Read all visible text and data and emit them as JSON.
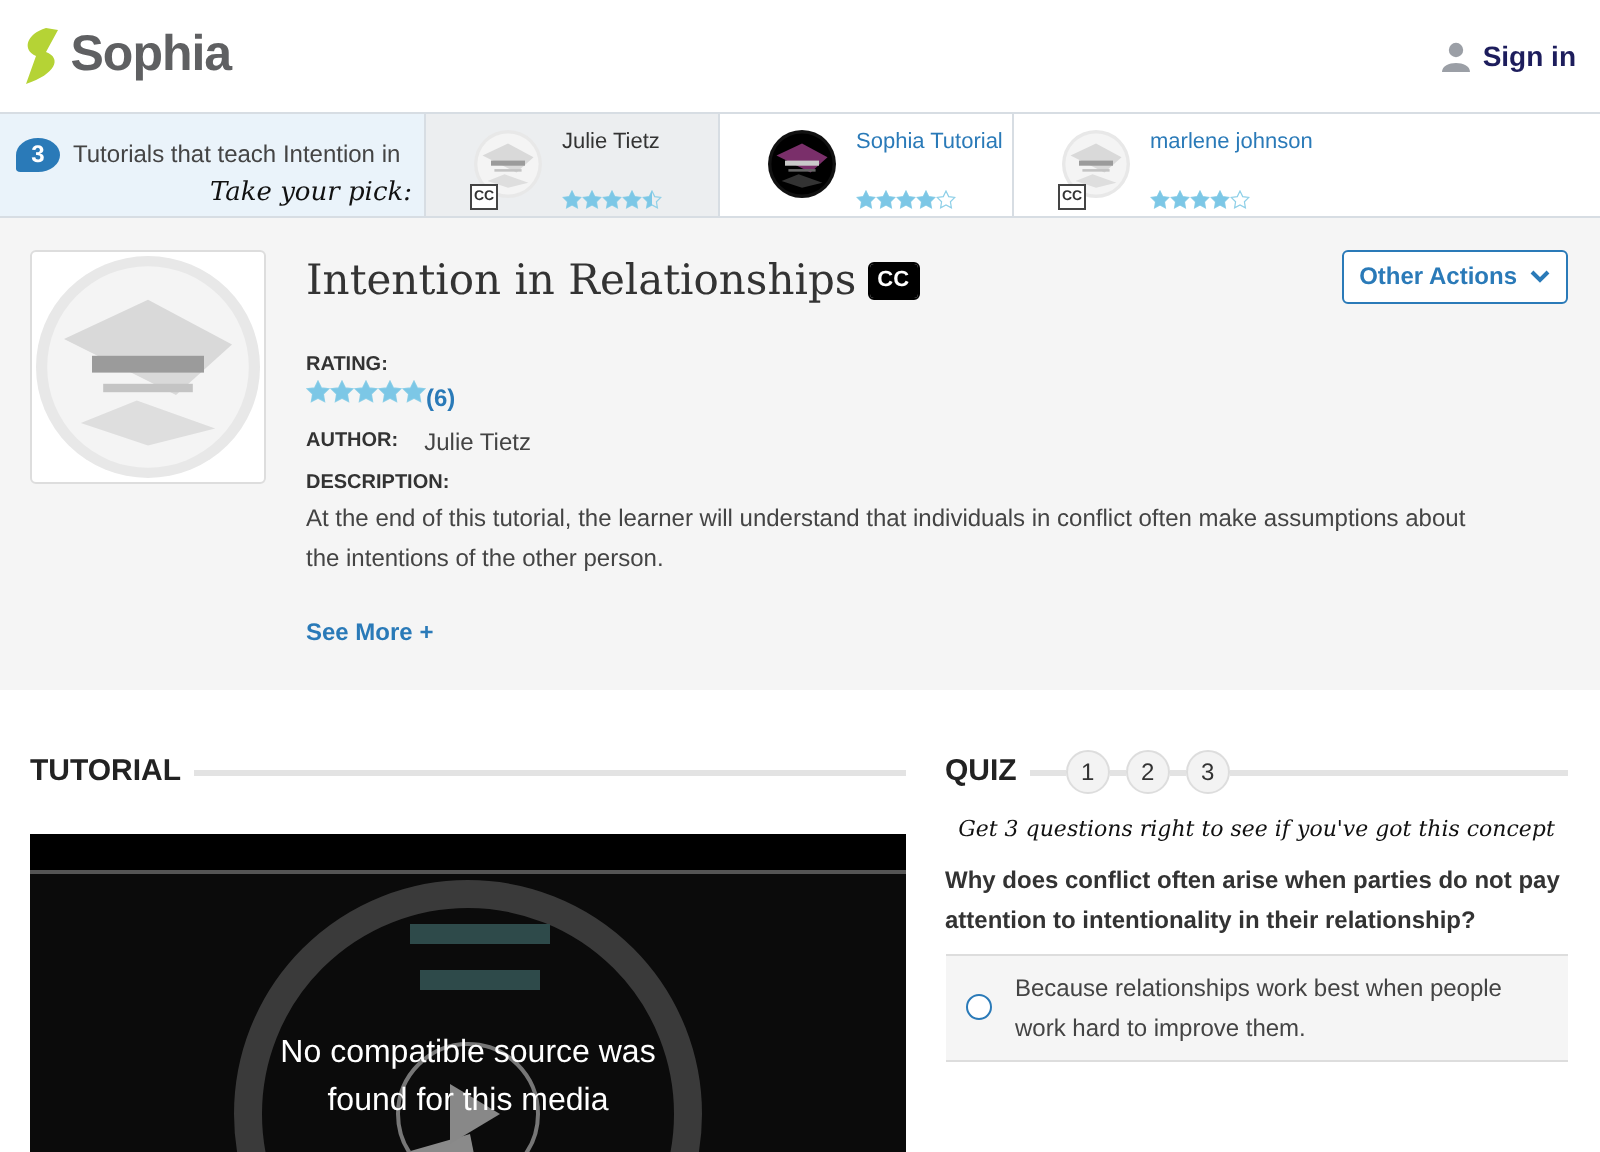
{
  "header": {
    "logo": "Sophia",
    "sign_in": "Sign in"
  },
  "tutorials_strip": {
    "count": "3",
    "text": "Tutorials that teach Intention in",
    "pick": "Take your pick:",
    "items": [
      {
        "author": "Julie Tietz",
        "stars": 4.5,
        "cc": "CC",
        "selected": true
      },
      {
        "author": "Sophia Tutorial",
        "stars": 4,
        "selected": false
      },
      {
        "author": "marlene johnson",
        "stars": 4,
        "cc": "CC",
        "selected": false
      }
    ]
  },
  "details": {
    "title": "Intention in Relationships",
    "cc": "CC",
    "rating_label": "RATING:",
    "stars": 5,
    "rating_count": "(6)",
    "author_label": "AUTHOR:",
    "author": "Julie Tietz",
    "description_label": "DESCRIPTION:",
    "description": "At the end of this tutorial, the learner will understand that individuals in conflict often make assumptions about the intentions of the other person.",
    "see_more": "See More +",
    "actions": "Other Actions"
  },
  "tutorial": {
    "heading": "TUTORIAL",
    "video_message": "No compatible source was found for this media"
  },
  "quiz": {
    "heading": "QUIZ",
    "steps": [
      "1",
      "2",
      "3"
    ],
    "tagline": "Get 3 questions right to see if you've got this concept",
    "question": "Why does conflict often arise when parties do not pay attention to intentionality in their relationship?",
    "answers": [
      {
        "text": "Because relationships work best when people work hard to improve them.",
        "checked": false
      }
    ]
  }
}
